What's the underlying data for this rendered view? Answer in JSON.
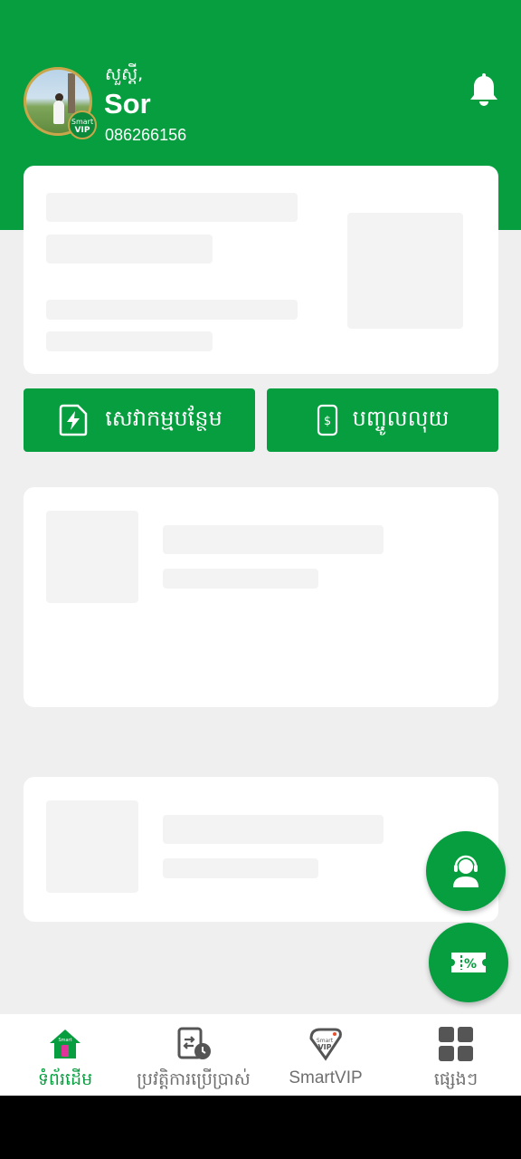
{
  "colors": {
    "brand_green": "#069e3f",
    "background": "#efefef",
    "card": "#ffffff"
  },
  "profile": {
    "greeting": "សួស្តី,",
    "name": "Sor",
    "phone": "086266156",
    "badge_line1": "Smart",
    "badge_line2": "VIP"
  },
  "header": {
    "notification_icon": "bell-icon"
  },
  "actions": {
    "top_up_extra": {
      "label": "សេវាកម្មបន្ថែម",
      "icon": "lightning-icon"
    },
    "top_up_money": {
      "label": "បញ្ចូលលុយ",
      "icon": "phone-dollar-icon"
    }
  },
  "fabs": {
    "support_icon": "headset-agent-icon",
    "promo_icon": "discount-ticket-icon"
  },
  "nav": {
    "items": [
      {
        "label": "ទំព័រដើម",
        "icon": "home-icon",
        "active": true
      },
      {
        "label": "ប្រវត្តិការប្រើប្រាស់",
        "icon": "usage-history-icon",
        "active": false
      },
      {
        "label": "SmartVIP",
        "icon": "smartvip-icon",
        "active": false
      },
      {
        "label": "ផ្សេងៗ",
        "icon": "grid-icon",
        "active": false
      }
    ]
  }
}
